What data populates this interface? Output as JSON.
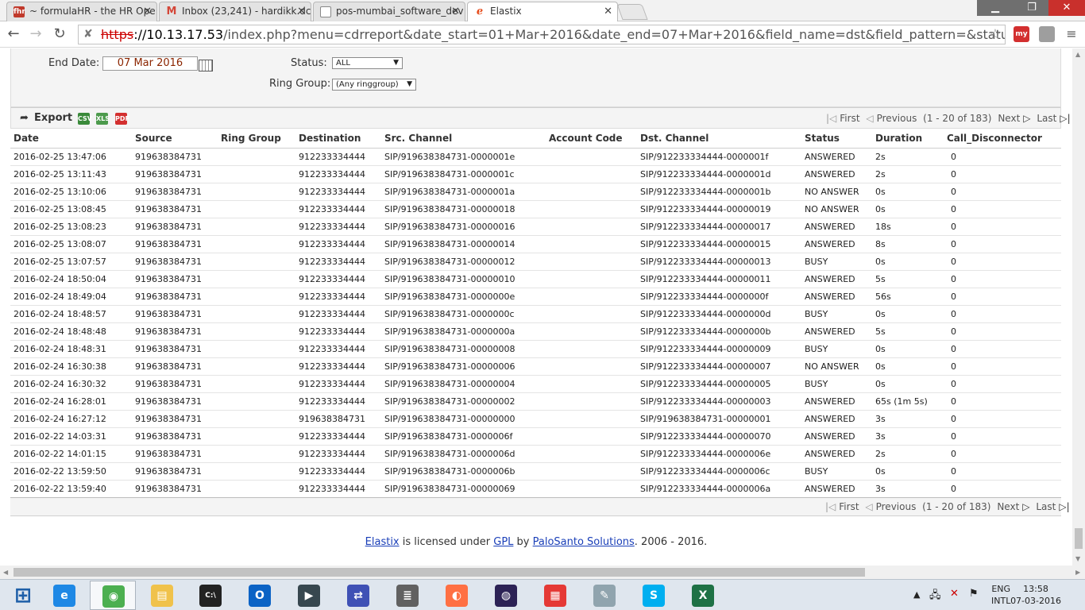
{
  "browser": {
    "tabs": [
      {
        "title": "~ formulaHR - the HR Ope",
        "favicon": "fhr-icon",
        "color": "#c0392b"
      },
      {
        "title": "Inbox (23,241) - hardikk.dc",
        "favicon": "gmail-icon",
        "color": "#d44638"
      },
      {
        "title": "pos-mumbai_software_dev",
        "favicon": "document-icon",
        "color": "#888888"
      },
      {
        "title": "Elastix",
        "favicon": "elastix-icon",
        "color": "#e64a19"
      }
    ],
    "url": {
      "scheme": "https",
      "host": "://10.13.17.53",
      "path": "/index.php?menu=cdrreport&date_start=01+Mar+2016&date_end=07+Mar+2016&field_name=dst&field_pattern=&status=ALL&ringgroup"
    },
    "extensions": [
      {
        "name": "my-extension-icon",
        "label": "my",
        "color": "#d32f2f"
      },
      {
        "name": "puzzle-extension-icon",
        "label": "",
        "color": "#9e9e9e"
      }
    ]
  },
  "filters": {
    "end_date_label": "End Date:",
    "end_date_value": "07 Mar 2016",
    "status_label": "Status:",
    "status_value": "ALL",
    "ring_group_label": "Ring Group:",
    "ring_group_value": "(Any ringgroup)"
  },
  "export": {
    "label": "Export",
    "icons": [
      {
        "name": "export-csv-icon",
        "text": "CSV",
        "color": "#3a8a3a"
      },
      {
        "name": "export-spreadsheet-icon",
        "text": "XLS",
        "color": "#4c9a4c"
      },
      {
        "name": "export-pdf-icon",
        "text": "PDF",
        "color": "#d32f2f"
      }
    ]
  },
  "pager": {
    "first": "First",
    "previous": "Previous",
    "range": "(1 - 20 of 183)",
    "next": "Next",
    "last": "Last"
  },
  "table": {
    "columns": [
      "Date",
      "Source",
      "Ring Group",
      "Destination",
      "Src. Channel",
      "Account Code",
      "Dst. Channel",
      "Status",
      "Duration",
      "Call_Disconnector"
    ],
    "rows": [
      [
        "2016-02-25 13:47:06",
        "919638384731",
        "",
        "912233334444",
        "SIP/919638384731-0000001e",
        "",
        "SIP/912233334444-0000001f",
        "ANSWERED",
        "2s",
        "0"
      ],
      [
        "2016-02-25 13:11:43",
        "919638384731",
        "",
        "912233334444",
        "SIP/919638384731-0000001c",
        "",
        "SIP/912233334444-0000001d",
        "ANSWERED",
        "2s",
        "0"
      ],
      [
        "2016-02-25 13:10:06",
        "919638384731",
        "",
        "912233334444",
        "SIP/919638384731-0000001a",
        "",
        "SIP/912233334444-0000001b",
        "NO ANSWER",
        "0s",
        "0"
      ],
      [
        "2016-02-25 13:08:45",
        "919638384731",
        "",
        "912233334444",
        "SIP/919638384731-00000018",
        "",
        "SIP/912233334444-00000019",
        "NO ANSWER",
        "0s",
        "0"
      ],
      [
        "2016-02-25 13:08:23",
        "919638384731",
        "",
        "912233334444",
        "SIP/919638384731-00000016",
        "",
        "SIP/912233334444-00000017",
        "ANSWERED",
        "18s",
        "0"
      ],
      [
        "2016-02-25 13:08:07",
        "919638384731",
        "",
        "912233334444",
        "SIP/919638384731-00000014",
        "",
        "SIP/912233334444-00000015",
        "ANSWERED",
        "8s",
        "0"
      ],
      [
        "2016-02-25 13:07:57",
        "919638384731",
        "",
        "912233334444",
        "SIP/919638384731-00000012",
        "",
        "SIP/912233334444-00000013",
        "BUSY",
        "0s",
        "0"
      ],
      [
        "2016-02-24 18:50:04",
        "919638384731",
        "",
        "912233334444",
        "SIP/919638384731-00000010",
        "",
        "SIP/912233334444-00000011",
        "ANSWERED",
        "5s",
        "0"
      ],
      [
        "2016-02-24 18:49:04",
        "919638384731",
        "",
        "912233334444",
        "SIP/919638384731-0000000e",
        "",
        "SIP/912233334444-0000000f",
        "ANSWERED",
        "56s",
        "0"
      ],
      [
        "2016-02-24 18:48:57",
        "919638384731",
        "",
        "912233334444",
        "SIP/919638384731-0000000c",
        "",
        "SIP/912233334444-0000000d",
        "BUSY",
        "0s",
        "0"
      ],
      [
        "2016-02-24 18:48:48",
        "919638384731",
        "",
        "912233334444",
        "SIP/919638384731-0000000a",
        "",
        "SIP/912233334444-0000000b",
        "ANSWERED",
        "5s",
        "0"
      ],
      [
        "2016-02-24 18:48:31",
        "919638384731",
        "",
        "912233334444",
        "SIP/919638384731-00000008",
        "",
        "SIP/912233334444-00000009",
        "BUSY",
        "0s",
        "0"
      ],
      [
        "2016-02-24 16:30:38",
        "919638384731",
        "",
        "912233334444",
        "SIP/919638384731-00000006",
        "",
        "SIP/912233334444-00000007",
        "NO ANSWER",
        "0s",
        "0"
      ],
      [
        "2016-02-24 16:30:32",
        "919638384731",
        "",
        "912233334444",
        "SIP/919638384731-00000004",
        "",
        "SIP/912233334444-00000005",
        "BUSY",
        "0s",
        "0"
      ],
      [
        "2016-02-24 16:28:01",
        "919638384731",
        "",
        "912233334444",
        "SIP/919638384731-00000002",
        "",
        "SIP/912233334444-00000003",
        "ANSWERED",
        "65s (1m 5s)",
        "0"
      ],
      [
        "2016-02-24 16:27:12",
        "919638384731",
        "",
        "919638384731",
        "SIP/919638384731-00000000",
        "",
        "SIP/919638384731-00000001",
        "ANSWERED",
        "3s",
        "0"
      ],
      [
        "2016-02-22 14:03:31",
        "919638384731",
        "",
        "912233334444",
        "SIP/919638384731-0000006f",
        "",
        "SIP/912233334444-00000070",
        "ANSWERED",
        "3s",
        "0"
      ],
      [
        "2016-02-22 14:01:15",
        "919638384731",
        "",
        "912233334444",
        "SIP/919638384731-0000006d",
        "",
        "SIP/912233334444-0000006e",
        "ANSWERED",
        "2s",
        "0"
      ],
      [
        "2016-02-22 13:59:50",
        "919638384731",
        "",
        "912233334444",
        "SIP/919638384731-0000006b",
        "",
        "SIP/912233334444-0000006c",
        "BUSY",
        "0s",
        "0"
      ],
      [
        "2016-02-22 13:59:40",
        "919638384731",
        "",
        "912233334444",
        "SIP/919638384731-00000069",
        "",
        "SIP/912233334444-0000006a",
        "ANSWERED",
        "3s",
        "0"
      ]
    ]
  },
  "footer": {
    "elastix": "Elastix",
    "licensed": " is licensed under ",
    "gpl": "GPL",
    "by": " by ",
    "palosanto": "PaloSanto Solutions",
    "years": ". 2006 - 2016."
  },
  "taskbar": {
    "apps": [
      {
        "name": "start-button",
        "color": "#1e73be"
      },
      {
        "name": "internet-explorer-icon",
        "color": "#1e88e5"
      },
      {
        "name": "chrome-icon",
        "color": "#4caf50"
      },
      {
        "name": "file-explorer-icon",
        "color": "#f0c24b"
      },
      {
        "name": "command-prompt-icon",
        "color": "#222222"
      },
      {
        "name": "outlook-icon",
        "color": "#0b63c5"
      },
      {
        "name": "remote-desktop-icon",
        "color": "#37474f"
      },
      {
        "name": "network-tool-icon",
        "color": "#3f51b5"
      },
      {
        "name": "database-icon",
        "color": "#616161"
      },
      {
        "name": "firefox-icon",
        "color": "#ff7043"
      },
      {
        "name": "eclipse-icon",
        "color": "#2c2255"
      },
      {
        "name": "app-grid-icon",
        "color": "#e53935"
      },
      {
        "name": "notepad-icon",
        "color": "#90a4ae"
      },
      {
        "name": "skype-icon",
        "color": "#00aff0"
      },
      {
        "name": "excel-icon",
        "color": "#1e7145"
      }
    ],
    "lang": "ENG",
    "layout": "INTL",
    "time": "13:58",
    "date": "07-03-2016"
  }
}
